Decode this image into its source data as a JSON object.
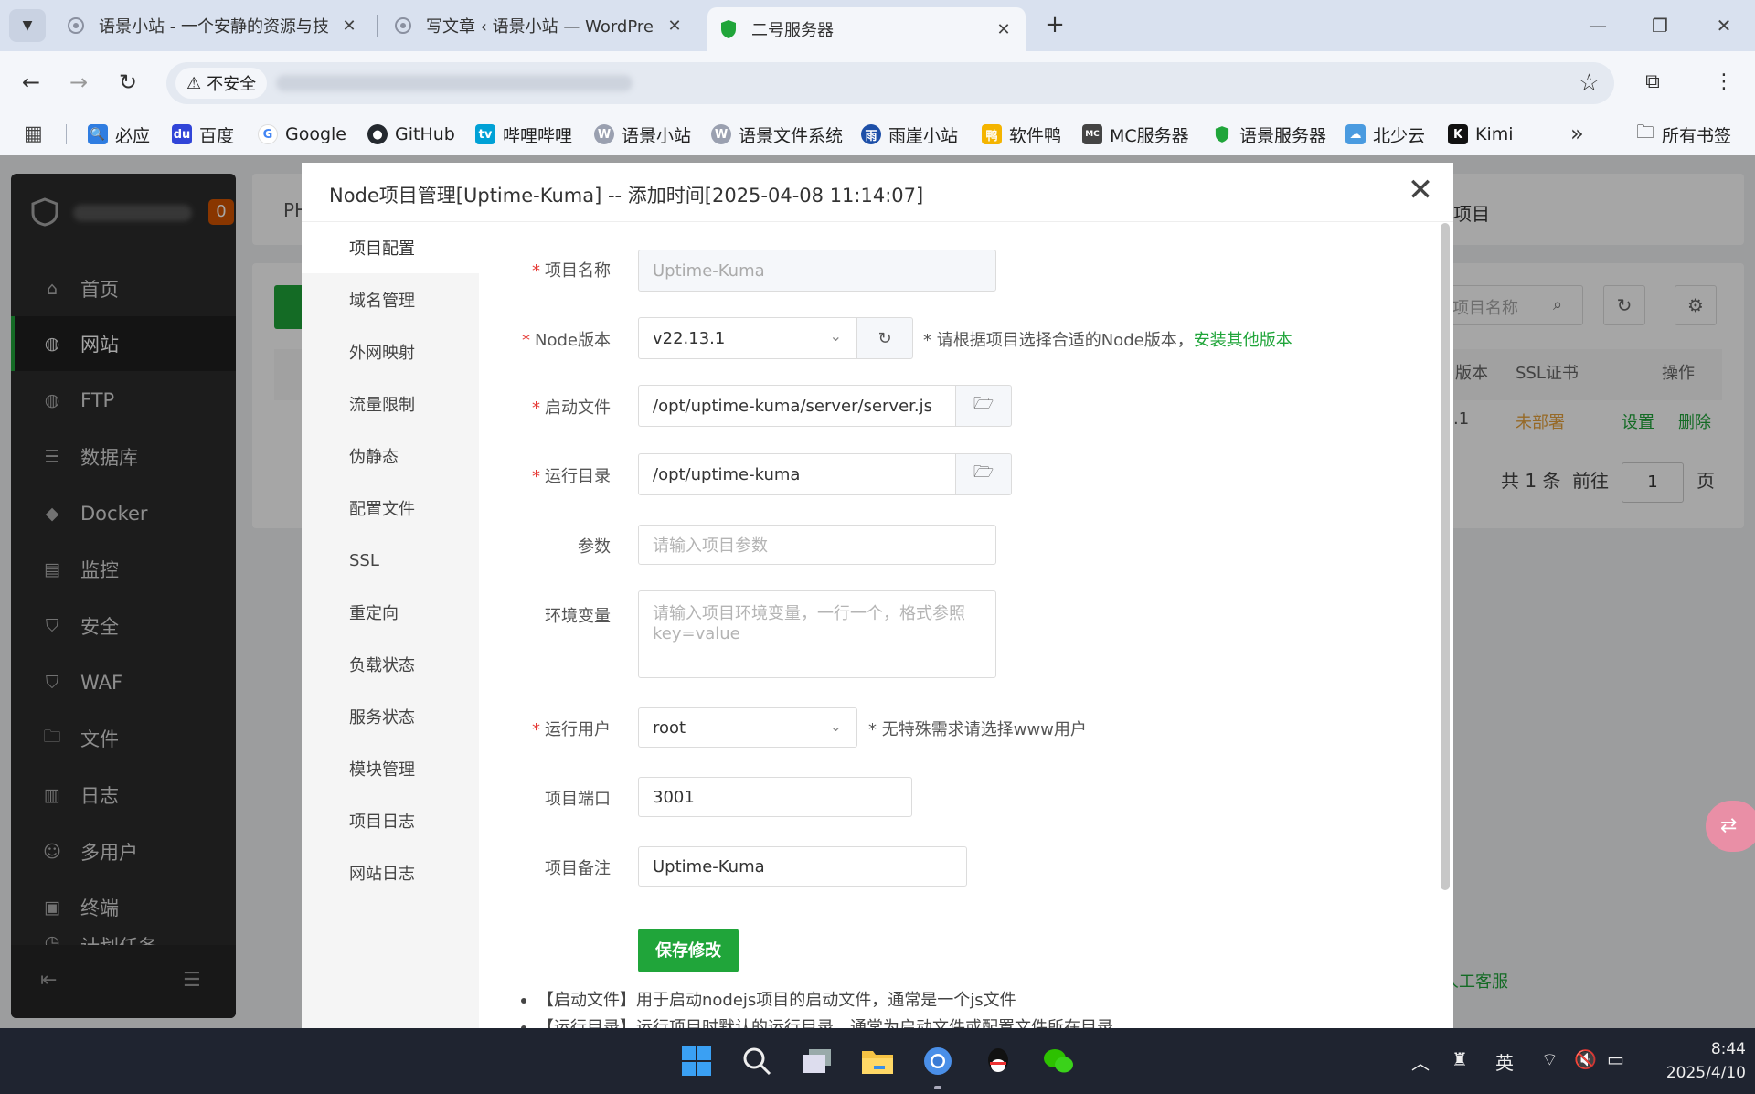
{
  "browser": {
    "tabs": [
      {
        "title": "语景小站 - 一个安静的资源与技",
        "active": false
      },
      {
        "title": "写文章 ‹ 语景小站 — WordPre",
        "active": false
      },
      {
        "title": "二号服务器",
        "active": true
      }
    ],
    "security_label": "不安全",
    "bookmarks": [
      {
        "label": "必应",
        "color": "#2f7de1"
      },
      {
        "label": "百度",
        "color": "#3145d8"
      },
      {
        "label": "Google",
        "color": "#4285f4"
      },
      {
        "label": "GitHub",
        "color": "#24292f"
      },
      {
        "label": "哔哩哔哩",
        "color": "#00a1d6"
      },
      {
        "label": "语景小站",
        "color": "#9aa0b0"
      },
      {
        "label": "语景文件系统",
        "color": "#9aa0b0"
      },
      {
        "label": "雨崖小站",
        "color": "#1d4fa8"
      },
      {
        "label": "软件鸭",
        "color": "#f4b400"
      },
      {
        "label": "MC服务器",
        "color": "#444444"
      },
      {
        "label": "语景服务器",
        "color": "#20a53a"
      },
      {
        "label": "北少云",
        "color": "#4a9be0"
      },
      {
        "label": "Kimi",
        "color": "#111111"
      }
    ],
    "all_bookmarks_label": "所有书签"
  },
  "sidebar": {
    "badge": "0",
    "items": [
      {
        "label": "首页",
        "icon": "home-icon"
      },
      {
        "label": "网站",
        "icon": "globe-icon",
        "active": true
      },
      {
        "label": "FTP",
        "icon": "ftp-icon"
      },
      {
        "label": "数据库",
        "icon": "database-icon"
      },
      {
        "label": "Docker",
        "icon": "docker-icon"
      },
      {
        "label": "监控",
        "icon": "monitor-icon"
      },
      {
        "label": "安全",
        "icon": "shield-icon"
      },
      {
        "label": "WAF",
        "icon": "waf-icon"
      },
      {
        "label": "文件",
        "icon": "folder-icon"
      },
      {
        "label": "日志",
        "icon": "log-icon"
      },
      {
        "label": "多用户",
        "icon": "users-icon"
      },
      {
        "label": "终端",
        "icon": "terminal-icon"
      },
      {
        "label": "计划任务",
        "icon": "cron-icon"
      }
    ]
  },
  "background": {
    "tab_ph": "PH",
    "tab_node": "项目",
    "search_placeholder": "项目名称",
    "col_version": "版本",
    "col_ssl": "SSL证书",
    "col_ops": "操作",
    "row_version": ".1",
    "row_ssl": "未部署",
    "row_settings": "设置",
    "row_delete": "删除",
    "pager_total": "共 1 条",
    "pager_goto": "前往",
    "pager_page": "1",
    "pager_unit": "页",
    "service_link": "人工客服"
  },
  "modal": {
    "title": "Node项目管理[Uptime-Kuma] -- 添加时间[2025-04-08 11:14:07]",
    "nav": [
      "项目配置",
      "域名管理",
      "外网映射",
      "流量限制",
      "伪静态",
      "配置文件",
      "SSL",
      "重定向",
      "负载状态",
      "服务状态",
      "模块管理",
      "项目日志",
      "网站日志"
    ],
    "form": {
      "name_label": "项目名称",
      "name_value": "Uptime-Kuma",
      "version_label": "Node版本",
      "version_value": "v22.13.1",
      "version_hint": "* 请根据项目选择合适的Node版本，",
      "version_link": "安装其他版本",
      "startfile_label": "启动文件",
      "startfile_value": "/opt/uptime-kuma/server/server.js",
      "rundir_label": "运行目录",
      "rundir_value": "/opt/uptime-kuma",
      "args_label": "参数",
      "args_placeholder": "请输入项目参数",
      "env_label": "环境变量",
      "env_placeholder": "请输入项目环境变量，一行一个，格式参照key=value",
      "user_label": "运行用户",
      "user_value": "root",
      "user_hint": "* 无特殊需求请选择www用户",
      "port_label": "项目端口",
      "port_value": "3001",
      "remark_label": "项目备注",
      "remark_value": "Uptime-Kuma",
      "save_label": "保存修改"
    },
    "notes": [
      "【启动文件】用于启动nodejs项目的启动文件，通常是一个js文件",
      "【运行目录】运行项目时默认的运行目录，通常为启动文件或配置文件所在目录"
    ]
  },
  "taskbar": {
    "ime": "英",
    "time": "8:44",
    "date": "2025/4/10"
  },
  "colors": {
    "accent": "#20a53a",
    "required": "#e53935",
    "warning": "#e6a23c"
  }
}
